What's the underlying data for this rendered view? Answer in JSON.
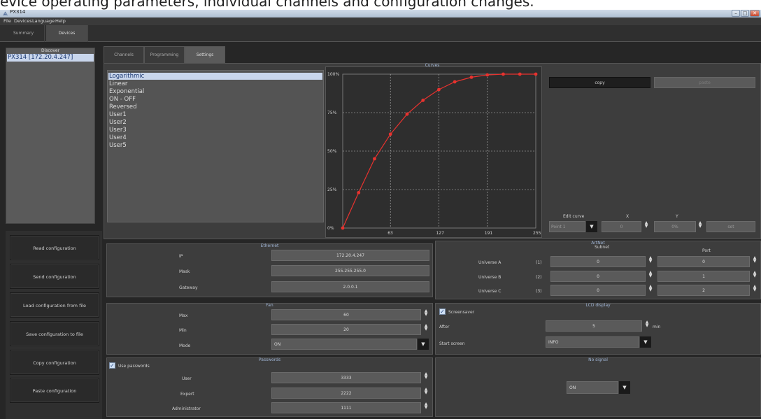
{
  "caption": "evice operating parameters, individual channels and configuration changes.",
  "window": {
    "title": "PX314",
    "min": "–",
    "max": "□",
    "close": "✕"
  },
  "menu": [
    "File",
    "Devices",
    "Language",
    "Help"
  ],
  "main_tabs": [
    "Summary",
    "Devices"
  ],
  "discover": {
    "header": "Discover",
    "device": "PX314 [172.20.4.247]"
  },
  "left_buttons": [
    "Read configuration",
    "Send configuration",
    "Load configuration from file",
    "Save configuration to file",
    "Copy configuration",
    "Paste configuration"
  ],
  "sub_tabs": [
    "Channels",
    "Programming",
    "Settings"
  ],
  "curves": {
    "title": "Curves",
    "items": [
      "Logarithmic",
      "Linear",
      "Exponential",
      "ON - OFF",
      "Reversed",
      "User1",
      "User2",
      "User3",
      "User4",
      "User5"
    ],
    "copy_label": "copy",
    "paste_label": "paste",
    "edit_curve_label": "Edit curve",
    "x_label": "X",
    "y_label": "Y",
    "point_value": "Point 1",
    "x_value": "0",
    "y_value": "0%",
    "set_label": "set"
  },
  "chart_data": {
    "type": "line",
    "x": [
      0,
      21,
      42,
      63,
      85,
      106,
      127,
      148,
      170,
      191,
      212,
      234,
      255
    ],
    "values": [
      0,
      23,
      45,
      61,
      74,
      83,
      90,
      95,
      98,
      99.5,
      100,
      100,
      100
    ],
    "xticks": [
      "63",
      "127",
      "191",
      "255"
    ],
    "yticks": [
      "0%",
      "25%",
      "50%",
      "75%",
      "100%"
    ],
    "xlim": [
      0,
      255
    ],
    "ylim": [
      0,
      100
    ],
    "grid": true,
    "color": "#e8322e"
  },
  "ethernet": {
    "title": "Ethernet",
    "ip_label": "IP",
    "ip": "172.20.4.247",
    "mask_label": "Mask",
    "mask": "255.255.255.0",
    "gateway_label": "Gateway",
    "gateway": "2.0.0.1"
  },
  "artnet": {
    "title": "ArtNet",
    "subnet_label": "Subnet",
    "port_label": "Port",
    "rows": [
      {
        "label": "Universe A",
        "idx": "(1)",
        "subnet": "0",
        "port": "0"
      },
      {
        "label": "Universe B",
        "idx": "(2)",
        "subnet": "0",
        "port": "1"
      },
      {
        "label": "Universe C",
        "idx": "(3)",
        "subnet": "0",
        "port": "2"
      }
    ]
  },
  "fan": {
    "title": "Fan",
    "max_label": "Max",
    "max": "60",
    "min_label": "Min",
    "min": "20",
    "mode_label": "Mode",
    "mode": "ON"
  },
  "lcd": {
    "title": "LCD display",
    "screensaver_label": "Screensaver",
    "after_label": "After",
    "after": "5",
    "unit": "min",
    "start_label": "Start screen",
    "start": "INFO"
  },
  "passwords": {
    "title": "Passwords",
    "use_label": "Use passwords",
    "user_label": "User",
    "user": "3333",
    "expert_label": "Expert",
    "expert": "2222",
    "admin_label": "Administrator",
    "admin": "1111"
  },
  "nosignal": {
    "title": "No signal",
    "value": "ON"
  }
}
